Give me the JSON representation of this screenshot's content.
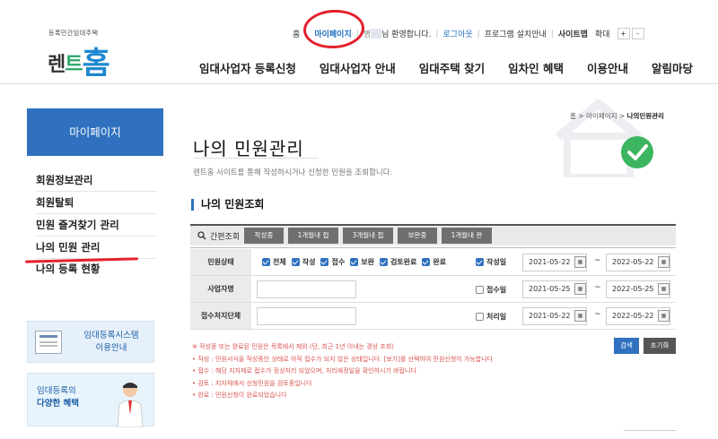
{
  "logo": {
    "subtitle": "등록민간임대주택",
    "part1": "렌",
    "part2": "트",
    "part3": "홈"
  },
  "util": {
    "home": "홈",
    "mypage": "마이페이지",
    "user_initial": "병",
    "welcome": "님 환영합니다.",
    "logout": "로그아웃",
    "program": "프로그램 설치안내",
    "sitemap": "사이트맵",
    "zoom_label": "확대",
    "zoom_in": "+",
    "zoom_out": "-"
  },
  "gnb": [
    "임대사업자 등록신청",
    "임대사업자 안내",
    "임대주택 찾기",
    "임차인 혜택",
    "이용안내",
    "알림마당"
  ],
  "sidebar": {
    "title": "마이페이지",
    "items": [
      "회원정보관리",
      "회원탈퇴",
      "민원 즐겨찾기 관리",
      "나의 민원 관리",
      "나의 등록 현황"
    ],
    "banner1": {
      "line1": "임대등록시스템",
      "line2": "이용안내"
    },
    "banner2": {
      "line1": "임대등록의",
      "line2": "다양한 혜택"
    }
  },
  "breadcrumb": {
    "home_icon": "home-icon",
    "level1": "홈",
    "level2": "마이페이지",
    "current": "나의민원관리",
    "sep": ">"
  },
  "page": {
    "title": "나의 민원관리",
    "description": "렌트홈 사이트를 통해 작성하시거나 신청한 민원을 조회합니다.",
    "section_title": "나의 민원조회"
  },
  "quick": {
    "label": "간편조회",
    "buttons": [
      "작성중",
      "1개월내 접수",
      "3개월내 접수",
      "보완중",
      "1개월내 완료"
    ]
  },
  "form": {
    "status": {
      "label": "민원상태",
      "options": [
        "전체",
        "작성",
        "접수",
        "보완",
        "검토완료",
        "완료"
      ]
    },
    "business": {
      "label": "사업자명",
      "value": ""
    },
    "agency": {
      "label": "접수처지단체",
      "value": ""
    },
    "dates": [
      {
        "label": "작성일",
        "checked": true,
        "from": "2021-05-22",
        "to": "2022-05-22"
      },
      {
        "label": "접수일",
        "checked": false,
        "from": "2021-05-25",
        "to": "2022-05-25"
      },
      {
        "label": "처리일",
        "checked": false,
        "from": "2021-05-22",
        "to": "2022-05-22"
      }
    ],
    "tilde": "~",
    "search": "검색",
    "reset": "초기화"
  },
  "notes": [
    "※ 작성중 또는 완료된 민원은 목록에서 제외 (단, 최근 1년 이내는 경상 조회)",
    "• 작성 : 민원서식을 작성중인 상태로 아직 접수가 되지 않은 상태입니다. [보기]를 선택하여 민원신청이 가능합니다",
    "• 접수 : 해당 지자체로 접수가 정상처리 되었으며, 처리예정일을 확인하시기 바랍니다",
    "• 검토 : 지자체에서 신청민원을 검토중입니다",
    "• 완료 : 민원신청이 완료되었습니다"
  ],
  "colors": {
    "accent": "#2f71bf",
    "highlight": "#e4202c",
    "note": "#d9544f"
  }
}
